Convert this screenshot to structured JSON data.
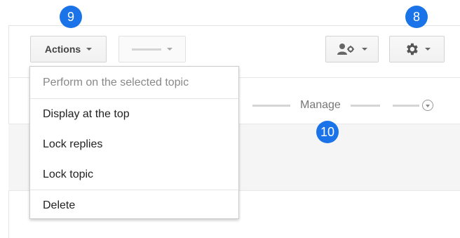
{
  "toolbar": {
    "actions_label": "Actions"
  },
  "badges": {
    "actions_badge": "9",
    "settings_badge": "8",
    "manage_badge": "10"
  },
  "manage": {
    "label": "Manage"
  },
  "dropdown": {
    "header": "Perform on the selected topic",
    "items": [
      {
        "label": "Display at the top"
      },
      {
        "label": "Lock replies"
      },
      {
        "label": "Lock topic"
      },
      {
        "label": "Delete"
      }
    ]
  },
  "icons": {
    "people_settings": "people-settings-icon",
    "gear": "gear-icon"
  },
  "colors": {
    "badge_blue": "#1a73e8"
  }
}
